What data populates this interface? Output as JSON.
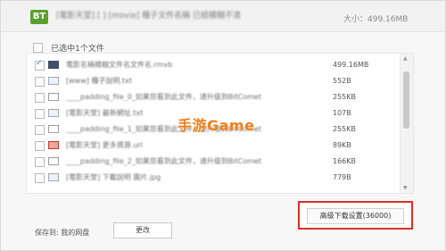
{
  "window": {
    "logo": "BT",
    "title": "[電影天堂] [ ] [movie] 種子文件名稱 已經模糊不清",
    "total_size": "大小：499.16MB"
  },
  "selection": {
    "label": "已选中1个文件"
  },
  "files": [
    {
      "name": "電影名稱模糊文件名文件名.rmvb",
      "size": "499.16MB",
      "checked": true,
      "icon": "video-file-icon"
    },
    {
      "name": "[www] 種子說明.txt",
      "size": "552B",
      "checked": false,
      "icon": "document-file-icon"
    },
    {
      "name": "____padding_file_0_如果您看到此文件，请升级到BitComet",
      "size": "255KB",
      "checked": false,
      "icon": "blank-file-icon"
    },
    {
      "name": "[電影天堂] 最新網址.txt",
      "size": "107B",
      "checked": false,
      "icon": "document-file-icon"
    },
    {
      "name": "____padding_file_1_如果您看到此文件，请升级到BitComet",
      "size": "255KB",
      "checked": false,
      "icon": "blank-file-icon"
    },
    {
      "name": "[電影天堂] 更多資源.url",
      "size": "89KB",
      "checked": false,
      "icon": "red-file-icon"
    },
    {
      "name": "____padding_file_2_如果您看到此文件，请升级到BitComet",
      "size": "166KB",
      "checked": false,
      "icon": "blank-file-icon"
    },
    {
      "name": "[電影天堂] 下載說明 圖片.jpg",
      "size": "779B",
      "checked": false,
      "icon": "image-file-icon"
    }
  ],
  "watermark": "手游Game",
  "advanced_button": "高级下载设置(36000)",
  "footer": {
    "save_to": "保存到: 我的网盘",
    "change_label": "更改"
  },
  "colors": {
    "highlight_border": "#d93025",
    "watermark": "#f07f1a",
    "logo_bg": "#5aa02c"
  }
}
